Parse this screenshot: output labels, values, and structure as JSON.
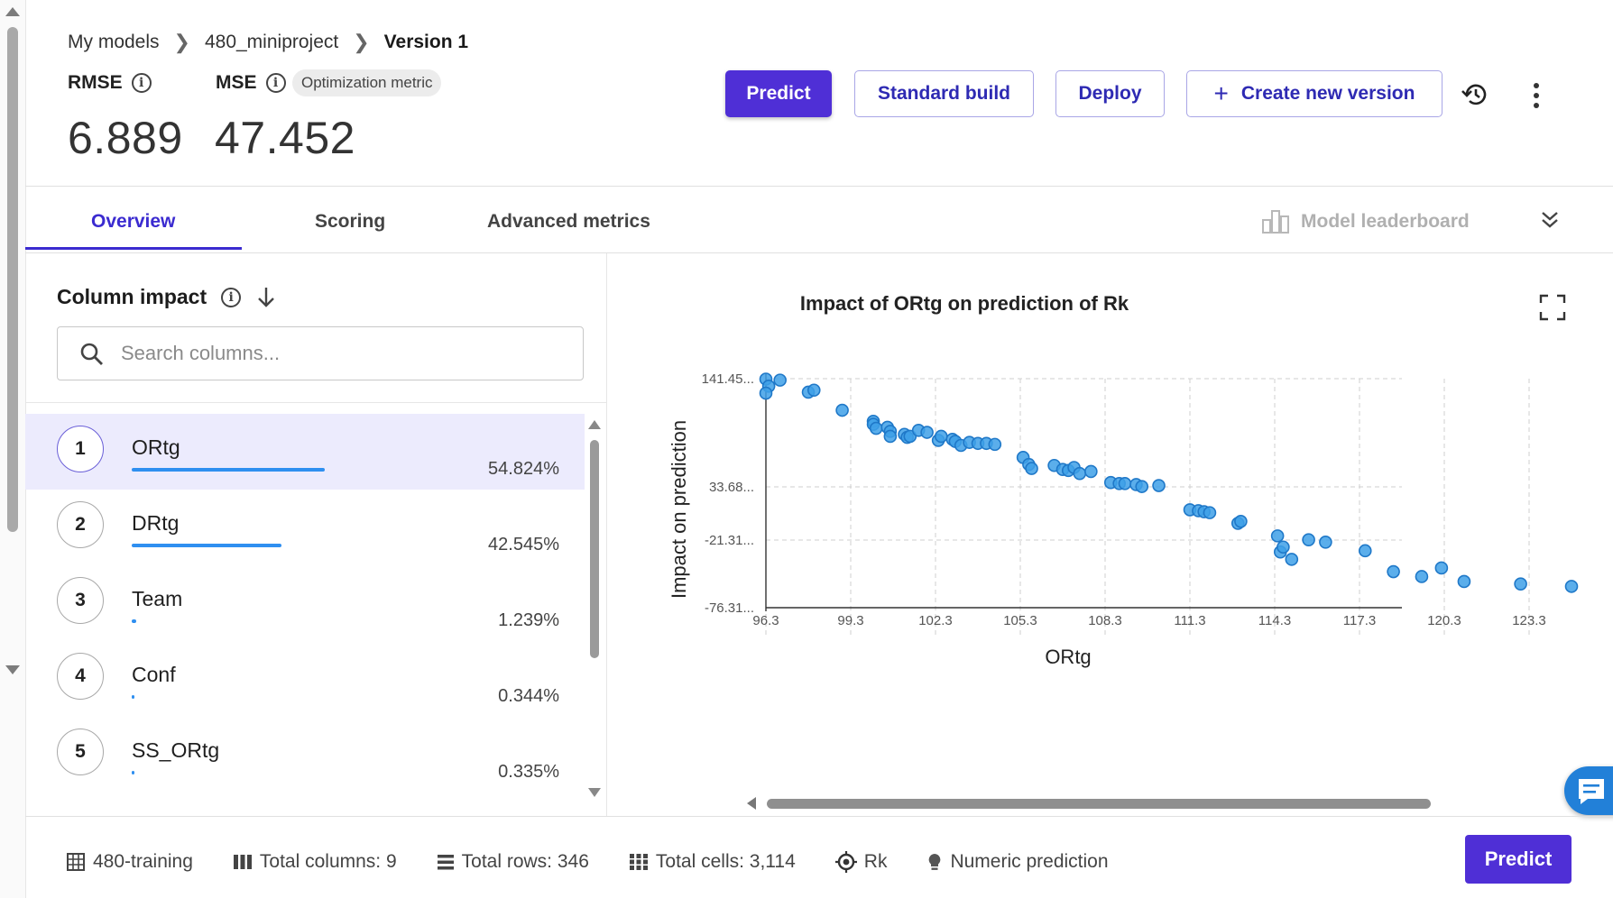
{
  "breadcrumb": [
    "My models",
    "480_miniproject",
    "Version 1"
  ],
  "metrics": {
    "rmse": {
      "label": "RMSE",
      "value": "6.889"
    },
    "mse": {
      "label": "MSE",
      "value": "47.452",
      "badge": "Optimization metric"
    }
  },
  "toolbar": {
    "predict": "Predict",
    "standard_build": "Standard build",
    "deploy": "Deploy",
    "create_version": "Create new version",
    "create_version_icon": "plus-icon",
    "history_icon": "history-icon",
    "more_icon": "more-vertical-icon"
  },
  "tabs": [
    {
      "label": "Overview",
      "active": true
    },
    {
      "label": "Scoring",
      "active": false
    },
    {
      "label": "Advanced metrics",
      "active": false
    }
  ],
  "leaderboard": {
    "label": "Model leaderboard",
    "enabled": false
  },
  "column_impact": {
    "title": "Column impact",
    "search_placeholder": "Search columns...",
    "items": [
      {
        "rank": "1",
        "name": "ORtg",
        "pct": "54.824%",
        "value": 54.824
      },
      {
        "rank": "2",
        "name": "DRtg",
        "pct": "42.545%",
        "value": 42.545
      },
      {
        "rank": "3",
        "name": "Team",
        "pct": "1.239%",
        "value": 1.239
      },
      {
        "rank": "4",
        "name": "Conf",
        "pct": "0.344%",
        "value": 0.344
      },
      {
        "rank": "5",
        "name": "SS_ORtg",
        "pct": "0.335%",
        "value": 0.335
      }
    ]
  },
  "chart_data": {
    "type": "scatter",
    "title": "Impact of ORtg on prediction of Rk",
    "xlabel": "ORtg",
    "ylabel": "Impact on prediction",
    "x_ticks": [
      "96.3",
      "99.3",
      "102.3",
      "105.3",
      "108.3",
      "111.3",
      "114.3",
      "117.3",
      "120.3",
      "123.3"
    ],
    "y_ticks": [
      "141.45...",
      "33.68...",
      "-21.31...",
      "-76.31..."
    ],
    "xlim": [
      96.3,
      125.0
    ],
    "ylim": [
      -76.31,
      141.45
    ],
    "grid": true,
    "color": "#3ea0e8",
    "points": [
      [
        96.3,
        141.0
      ],
      [
        96.4,
        134.0
      ],
      [
        96.3,
        127.0
      ],
      [
        96.8,
        140.0
      ],
      [
        97.8,
        128.0
      ],
      [
        98.0,
        130.0
      ],
      [
        99.0,
        110.0
      ],
      [
        100.1,
        99.0
      ],
      [
        100.1,
        96.0
      ],
      [
        100.2,
        92.0
      ],
      [
        100.6,
        93.0
      ],
      [
        100.7,
        89.0
      ],
      [
        100.7,
        84.0
      ],
      [
        101.2,
        86.0
      ],
      [
        101.3,
        83.0
      ],
      [
        101.4,
        84.0
      ],
      [
        101.7,
        90.0
      ],
      [
        102.0,
        88.0
      ],
      [
        102.4,
        80.0
      ],
      [
        102.5,
        84.0
      ],
      [
        102.9,
        81.0
      ],
      [
        103.0,
        79.0
      ],
      [
        103.2,
        75.0
      ],
      [
        103.5,
        78.0
      ],
      [
        103.8,
        77.0
      ],
      [
        104.1,
        77.0
      ],
      [
        104.4,
        76.0
      ],
      [
        105.4,
        63.0
      ],
      [
        105.6,
        56.0
      ],
      [
        105.7,
        52.0
      ],
      [
        106.5,
        55.0
      ],
      [
        106.8,
        51.0
      ],
      [
        107.0,
        50.0
      ],
      [
        107.2,
        53.0
      ],
      [
        107.4,
        47.0
      ],
      [
        107.8,
        49.0
      ],
      [
        108.5,
        38.0
      ],
      [
        108.8,
        37.0
      ],
      [
        109.0,
        37.0
      ],
      [
        109.4,
        36.0
      ],
      [
        109.6,
        34.0
      ],
      [
        110.2,
        35.0
      ],
      [
        111.3,
        10.0
      ],
      [
        111.6,
        9.0
      ],
      [
        111.8,
        8.0
      ],
      [
        112.0,
        7.0
      ],
      [
        113.0,
        -4.0
      ],
      [
        113.1,
        -2.0
      ],
      [
        114.4,
        -17.0
      ],
      [
        114.5,
        -31.0
      ],
      [
        114.6,
        -27.0
      ],
      [
        114.9,
        -37.0
      ],
      [
        115.5,
        -21.0
      ],
      [
        116.1,
        -23.0
      ],
      [
        117.5,
        -30.0
      ],
      [
        118.5,
        -47.0
      ],
      [
        119.5,
        -51.0
      ],
      [
        120.2,
        -44.0
      ],
      [
        121.0,
        -55.0
      ],
      [
        123.0,
        -57.0
      ],
      [
        124.8,
        -59.0
      ]
    ]
  },
  "footer": {
    "dataset": "480-training",
    "total_columns": "Total columns: 9",
    "total_rows": "Total rows: 346",
    "total_cells": "Total cells: 3,114",
    "target": "Rk",
    "prediction_type": "Numeric prediction",
    "predict": "Predict"
  }
}
